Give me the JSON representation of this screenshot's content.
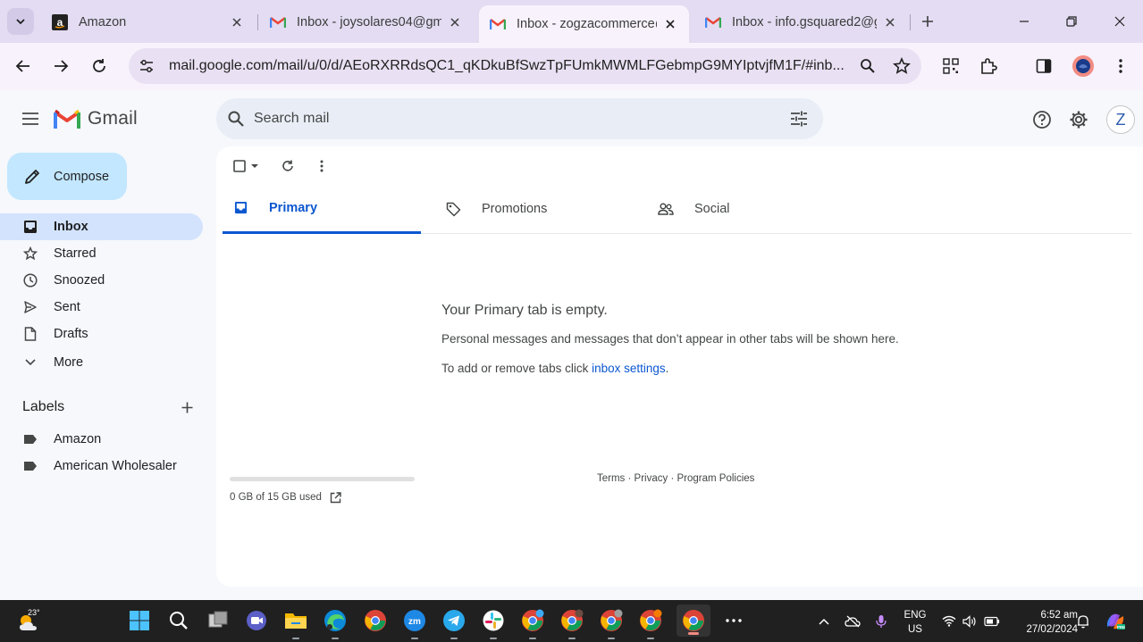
{
  "browser": {
    "tabs": [
      {
        "title": "Amazon",
        "favicon": "amazon-favicon",
        "active": false
      },
      {
        "title": "Inbox - joysolares04@gm",
        "favicon": "gmail-favicon",
        "active": false
      },
      {
        "title": "Inbox - zogzacommerce@",
        "favicon": "gmail-favicon",
        "active": true
      },
      {
        "title": "Inbox - info.gsquared2@g",
        "favicon": "gmail-favicon",
        "active": false
      }
    ],
    "url": "mail.google.com/mail/u/0/d/AEoRXRRdsQC1_qKDkuBfSwzTpFUmkMWMLFGebmpG9MYIptvjfM1F/#inb..."
  },
  "gmail": {
    "brand": "Gmail",
    "search_placeholder": "Search mail",
    "account_initial": "Z",
    "compose_label": "Compose",
    "nav": [
      {
        "label": "Inbox",
        "icon": "inbox-icon",
        "active": true
      },
      {
        "label": "Starred",
        "icon": "star-icon",
        "active": false
      },
      {
        "label": "Snoozed",
        "icon": "clock-icon",
        "active": false
      },
      {
        "label": "Sent",
        "icon": "send-icon",
        "active": false
      },
      {
        "label": "Drafts",
        "icon": "draft-icon",
        "active": false
      },
      {
        "label": "More",
        "icon": "chevron-down-icon",
        "active": false
      }
    ],
    "labels_heading": "Labels",
    "labels": [
      "Amazon",
      "American Wholesaler"
    ],
    "tabs": [
      {
        "label": "Primary",
        "icon": "inbox-icon",
        "active": true
      },
      {
        "label": "Promotions",
        "icon": "tag-icon",
        "active": false
      },
      {
        "label": "Social",
        "icon": "people-icon",
        "active": false
      }
    ],
    "empty": {
      "title": "Your Primary tab is empty.",
      "line1": "Personal messages and messages that don’t appear in other tabs will be shown here.",
      "line2_prefix": "To add or remove tabs click ",
      "line2_link": "inbox settings",
      "line2_suffix": "."
    },
    "storage": {
      "text": "0 GB of 15 GB used",
      "fraction": 0.0
    },
    "footer": {
      "terms": "Terms",
      "privacy": "Privacy",
      "policies": "Program Policies",
      "sep": " · "
    }
  },
  "taskbar": {
    "temperature": "23°",
    "language": "ENG",
    "region": "US",
    "time": "6:52 am",
    "date": "27/02/2024"
  },
  "colors": {
    "tabstrip": "#e3dcf2",
    "toolbar": "#f7f2fc",
    "accent": "#0b57d0",
    "compose": "#c2e7ff",
    "nav_active": "#d3e3fd",
    "taskbar": "#202020"
  }
}
